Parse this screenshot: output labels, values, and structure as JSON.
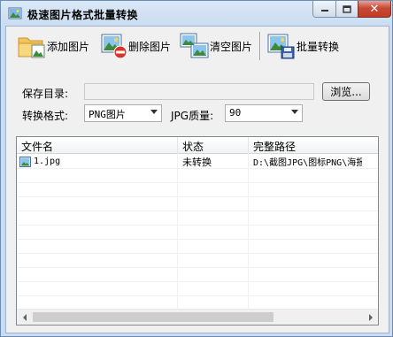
{
  "window": {
    "title": "极速图片格式批量转换",
    "close_glyph": "✕"
  },
  "toolbar": {
    "add_label": "添加图片",
    "delete_label": "删除图片",
    "clear_label": "清空图片",
    "convert_label": "批量转换"
  },
  "form": {
    "save_dir_label": "保存目录:",
    "save_dir_value": "",
    "browse_label": "浏览...",
    "format_label": "转换格式:",
    "format_value": "PNG图片",
    "quality_label": "JPG质量:",
    "quality_value": "90"
  },
  "table": {
    "headers": [
      "文件名",
      "状态",
      "完整路径"
    ],
    "rows": [
      {
        "name": "1.jpg",
        "status": "未转换",
        "path": "D:\\截图JPG\\图标PNG\\海报\\"
      }
    ]
  },
  "icons": {
    "app": "app-image-icon",
    "add": "folder-add-icon",
    "delete": "image-delete-icon",
    "clear": "images-clear-icon",
    "convert": "image-save-icon"
  },
  "colors": {
    "accent": "#c23b24",
    "titlebar": "#c9dcf1"
  }
}
